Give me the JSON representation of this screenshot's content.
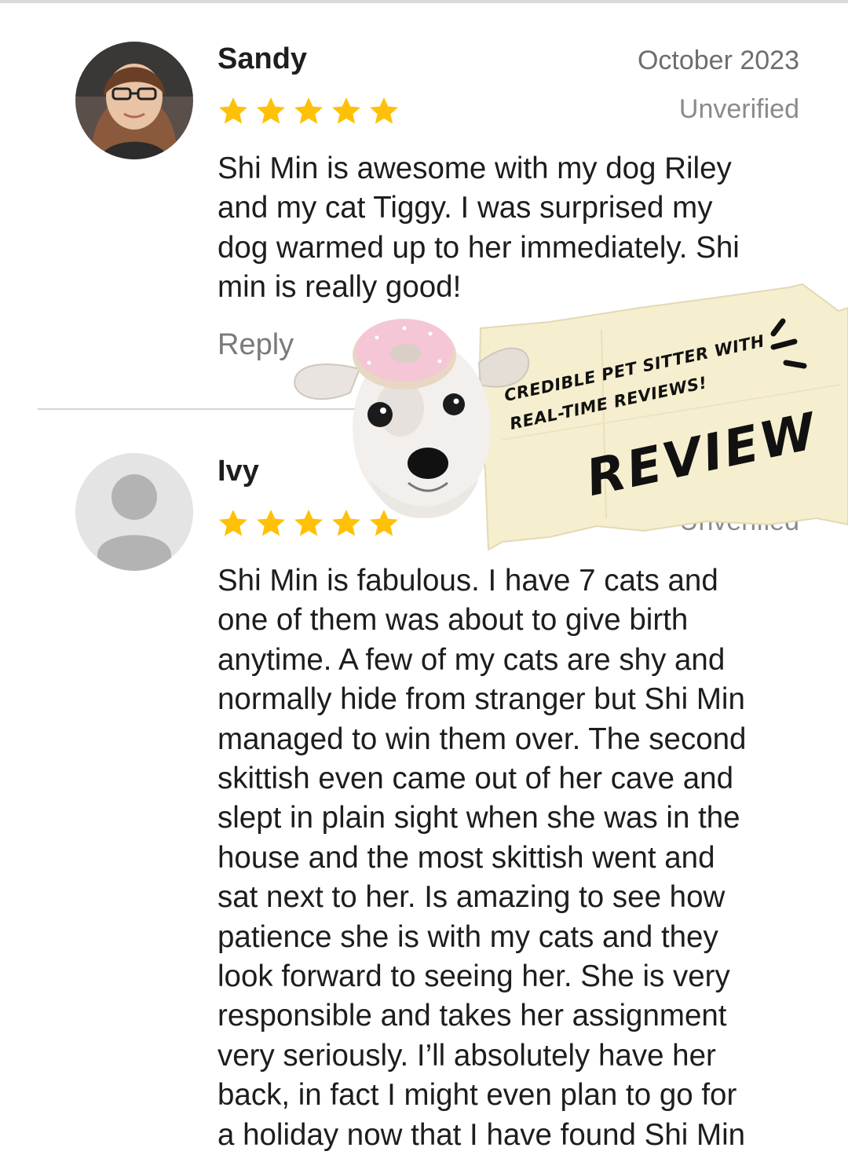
{
  "reviews": [
    {
      "name": "Sandy",
      "date": "October 2023",
      "status": "Unverified",
      "rating": 5,
      "text": "Shi Min is awesome with my dog Riley\nand my cat Tiggy. I was surprised my\ndog warmed up to her immediately. Shi\nmin is really good!",
      "reply_label": "Reply"
    },
    {
      "name": "Ivy",
      "status": "Unverified",
      "rating": 5,
      "text": "Shi Min is fabulous. I have 7 cats and\none of them was about to give birth\nanytime. A few of my cats are shy and\nnormally hide from stranger but Shi Min\nmanaged to win them over. The second\nskittish even came out of her cave and\nslept in plain sight when she was in the\nhouse and the most skittish went and\nsat next to her. Is amazing to see how\npatience she is with my cats and they\nlook forward to seeing her. She is very\nresponsible and takes her assignment\nvery seriously. I’ll absolutely have her\nback, in fact I might even plan to go for\na holiday now that I have found Shi Min"
    }
  ],
  "promo": {
    "tagline_1": "CREDIBLE PET SITTER WITH",
    "tagline_2": "REAL-TIME REVIEWS!",
    "headline": "REVIEW",
    "note_color": "#f6efcf",
    "donut_color": "#f5c6d6"
  },
  "colors": {
    "star": "#ffc107",
    "muted_text": "#7a7a7a",
    "divider": "#d4d4d4"
  }
}
